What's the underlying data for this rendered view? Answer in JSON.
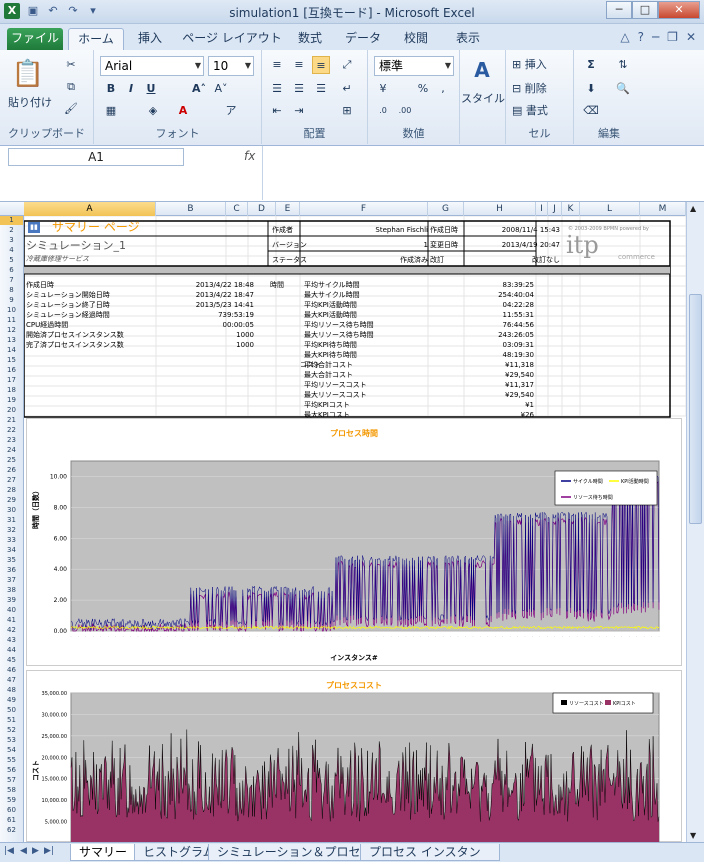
{
  "window": {
    "title": "simulation1 [互換モード] - Microsoft Excel"
  },
  "ribbon": {
    "tabs": [
      "ファイル",
      "ホーム",
      "挿入",
      "ページ レイアウト",
      "数式",
      "データ",
      "校閲",
      "表示"
    ],
    "font_name": "Arial",
    "font_size": "10",
    "number_format": "標準",
    "clipboard": {
      "paste": "貼り付け",
      "label": "クリップボード"
    },
    "font_label": "フォント",
    "alignment_label": "配置",
    "number_label": "数値",
    "styles": {
      "btn": "スタイル"
    },
    "cells": {
      "insert": "挿入",
      "delete": "削除",
      "format": "書式",
      "label": "セル"
    },
    "editing_label": "編集"
  },
  "formula_bar": {
    "name_box": "A1",
    "fx": "fx"
  },
  "columns": [
    "A",
    "B",
    "C",
    "D",
    "E",
    "F",
    "G",
    "H",
    "I",
    "J",
    "K",
    "L",
    "M"
  ],
  "rows": [
    "1",
    "2",
    "3",
    "4",
    "5",
    "6",
    "7",
    "8",
    "9",
    "10",
    "11",
    "12",
    "13",
    "14",
    "15",
    "16",
    "17",
    "18",
    "19",
    "20",
    "21",
    "22",
    "23",
    "24",
    "25",
    "26",
    "27",
    "28",
    "29",
    "30",
    "31",
    "32",
    "33",
    "34",
    "35",
    "36",
    "37",
    "38",
    "39",
    "40",
    "41",
    "42",
    "43",
    "44",
    "45",
    "46",
    "47",
    "48",
    "49",
    "50",
    "51",
    "52",
    "53",
    "54",
    "55",
    "56",
    "57",
    "58",
    "59",
    "60",
    "61",
    "62"
  ],
  "summary": {
    "title": "サマリー ページ",
    "subtitle": "シミュレーション_1",
    "desc": "冷蔵庫修理サービス",
    "author_label": "作成者",
    "author": "Stephan Fischli",
    "created_label": "作成日時",
    "created": "2008/11/4 15:43",
    "version_label": "バージョン",
    "version": "1",
    "modified_label": "変更日時",
    "modified": "2013/4/19 20:47",
    "status_label": "ステータス",
    "status": "作成済み",
    "revision_label": "改訂",
    "revision": "改訂なし",
    "logo_text": "itp",
    "logo_sub": "commerce",
    "logo_pre": "© 2003-2009 BPMN powered by"
  },
  "stats_left": [
    {
      "label": "作成日時",
      "value": "2013/4/22 18:48"
    },
    {
      "label": "シミュレーション開始日時",
      "value": "2013/4/22 18:47"
    },
    {
      "label": "シミュレーション終了日時",
      "value": "2013/5/23 14:41"
    },
    {
      "label": "シミュレーション経過時間",
      "value": "739:53:19"
    },
    {
      "label": "CPU経過時間",
      "value": "00:00:05"
    },
    {
      "label": "開始済プロセスインスタンス数",
      "value": "1000"
    },
    {
      "label": "完了済プロセスインスタンス数",
      "value": "1000"
    }
  ],
  "time_label": "時間",
  "cost_label": "コスト",
  "time_stats": [
    {
      "label": "平均サイクル時間",
      "value": "83:39:25"
    },
    {
      "label": "最大サイクル時間",
      "value": "254:40:04"
    },
    {
      "label": "平均KPI活動時間",
      "value": "04:22:28"
    },
    {
      "label": "最大KPI活動時間",
      "value": "11:55:31"
    },
    {
      "label": "平均リソース待ち時間",
      "value": "76:44:56"
    },
    {
      "label": "最大リソース待ち時間",
      "value": "243:26:05"
    },
    {
      "label": "平均KPI待ち時間",
      "value": "03:09:31"
    },
    {
      "label": "最大KPI待ち時間",
      "value": "48:19:30"
    }
  ],
  "cost_stats": [
    {
      "label": "平均合計コスト",
      "value": "¥11,318"
    },
    {
      "label": "最大合計コスト",
      "value": "¥29,540"
    },
    {
      "label": "平均リソースコスト",
      "value": "¥11,317"
    },
    {
      "label": "最大リソースコスト",
      "value": "¥29,540"
    },
    {
      "label": "平均KPIコスト",
      "value": "¥1"
    },
    {
      "label": "最大KPIコスト",
      "value": "¥26"
    }
  ],
  "chart_data": [
    {
      "type": "line",
      "title": "プロセス時間",
      "xlabel": "インスタンス#",
      "ylabel": "時間（日数）",
      "ylim": [
        0,
        11
      ],
      "yticks": [
        "0.00",
        "2.00",
        "4.00",
        "6.00",
        "8.00",
        "10.00"
      ],
      "series": [
        {
          "name": "サイクル時間",
          "color": "#000080"
        },
        {
          "name": "KPI活動時間",
          "color": "#ffff00"
        },
        {
          "name": "リソース待ち時間",
          "color": "#800080"
        }
      ]
    },
    {
      "type": "area",
      "title": "プロセスコスト",
      "ylim": [
        0,
        35000
      ],
      "yticks": [
        "5,000.00",
        "10,000.00",
        "15,000.00",
        "20,000.00",
        "25,000.00",
        "30,000.00",
        "35,000.00"
      ],
      "ylabel": "コスト",
      "series": [
        {
          "name": "リソースコスト",
          "color": "#000000"
        },
        {
          "name": "KPIコスト",
          "color": "#993366"
        }
      ]
    }
  ],
  "sheets": [
    "サマリー",
    "ヒストグラム",
    "シミュレーション＆プロセス",
    "プロセス インスタンス トレース"
  ]
}
